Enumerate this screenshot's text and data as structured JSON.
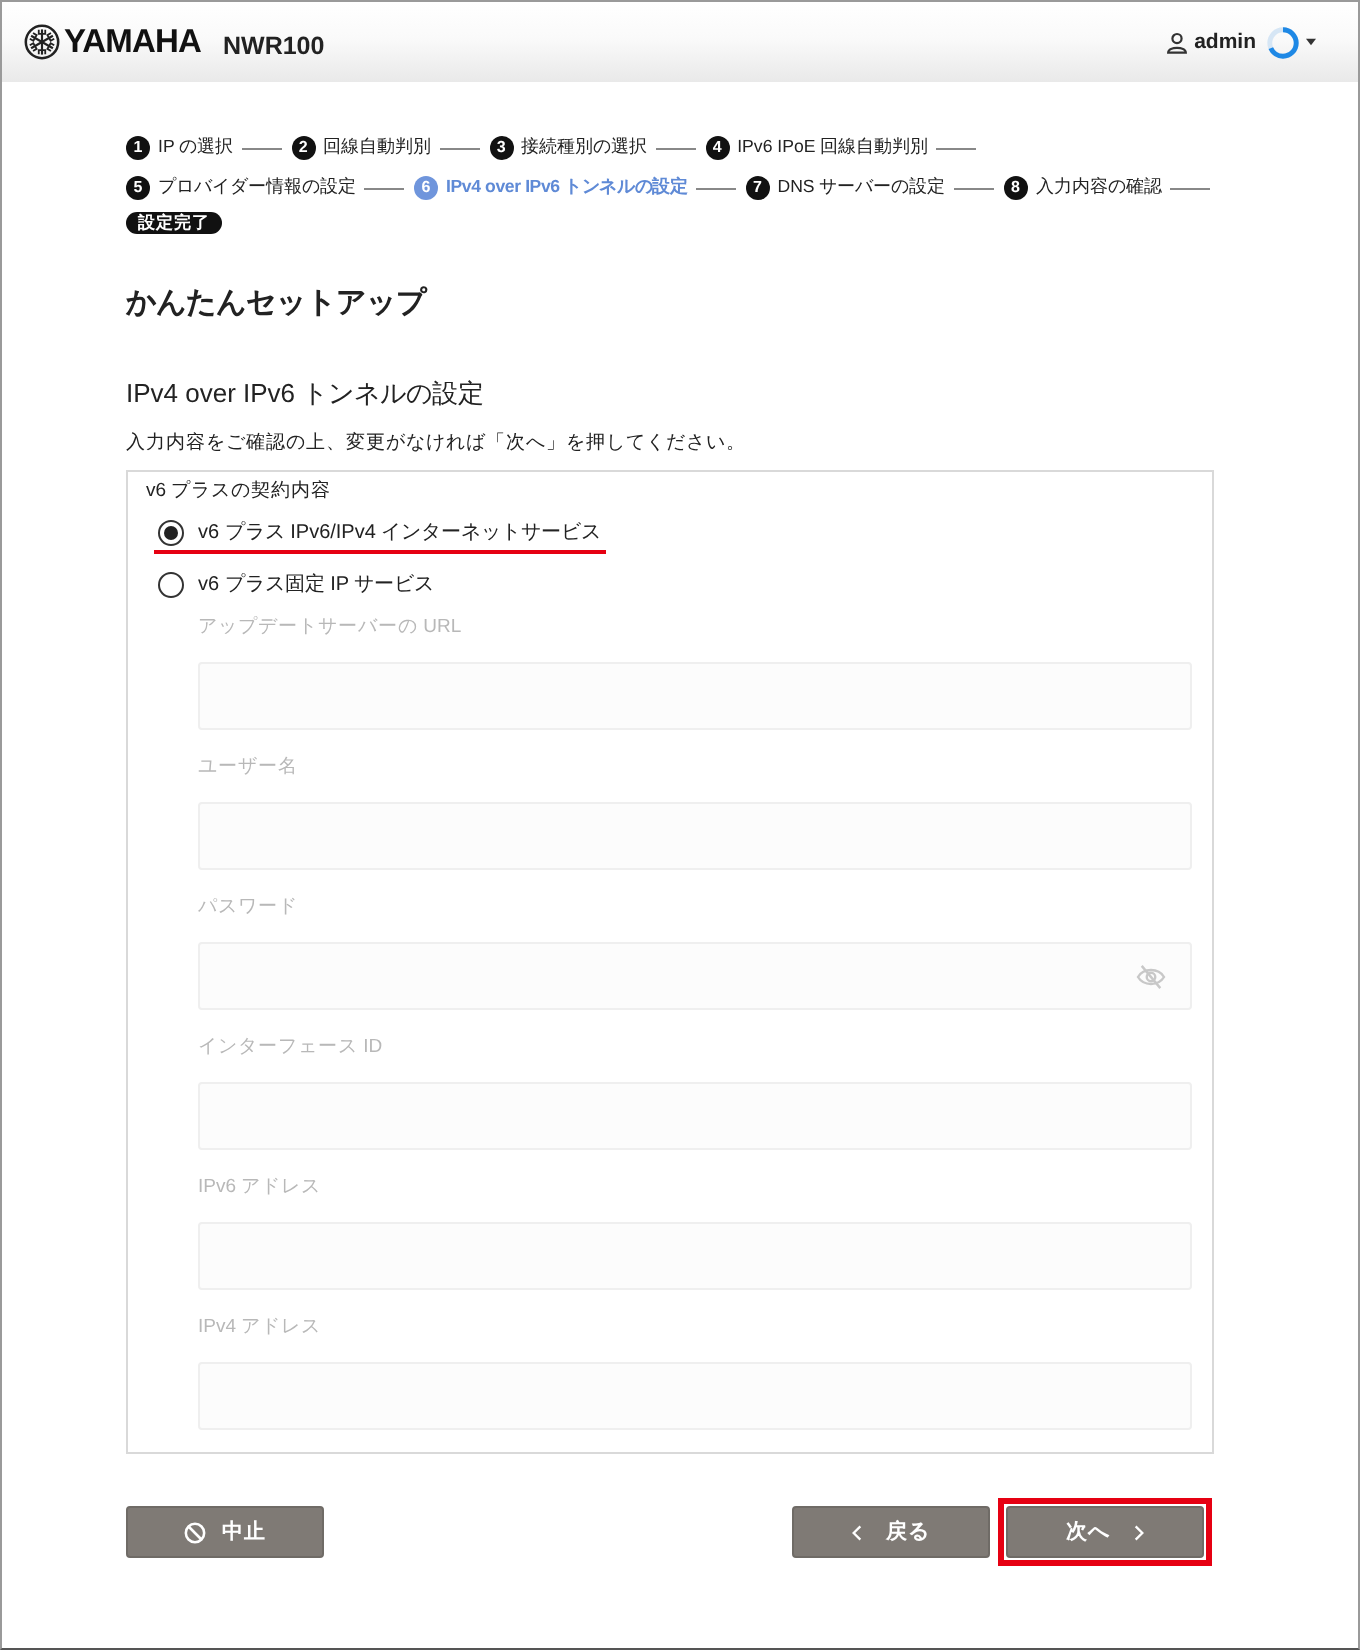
{
  "header": {
    "brand": "YAMAHA",
    "model": "NWR100",
    "user": "admin"
  },
  "steps": [
    {
      "number": "1",
      "label": "IP の選択",
      "selected": false
    },
    {
      "number": "2",
      "label": "回線自動判別",
      "selected": false
    },
    {
      "number": "3",
      "label": "接続種別の選択",
      "selected": false
    },
    {
      "number": "4",
      "label": "IPv6 IPoE 回線自動判別",
      "selected": false
    },
    {
      "number": "5",
      "label": "プロバイダー情報の設定",
      "selected": false
    },
    {
      "number": "6",
      "label": "IPv4 over IPv6 トンネルの設定",
      "selected": true
    },
    {
      "number": "7",
      "label": "DNS サーバーの設定",
      "selected": false
    },
    {
      "number": "8",
      "label": "入力内容の確認",
      "selected": false
    }
  ],
  "final_step": "設定完了",
  "page_title": "かんたんセットアップ",
  "section_title": "IPv4 over IPv6 トンネルの設定",
  "instruction": "入力内容をご確認の上、変更がなければ「次へ」を押してください。",
  "contract": {
    "label": "v6 プラスの契約内容",
    "options": [
      {
        "label": "v6 プラス IPv6/IPv4 インターネットサービス",
        "selected": true,
        "underlined": true
      },
      {
        "label": "v6 プラス固定 IP サービス",
        "selected": false,
        "underlined": false
      }
    ]
  },
  "fields": [
    {
      "label": "アップデートサーバーの URL",
      "kind": "text",
      "disabled": true
    },
    {
      "label": "ユーザー名",
      "kind": "text",
      "disabled": true
    },
    {
      "label": "パスワード",
      "kind": "password",
      "disabled": true
    },
    {
      "label": "インターフェース ID",
      "kind": "text",
      "disabled": true
    },
    {
      "label": "IPv6 アドレス",
      "kind": "text",
      "disabled": true
    },
    {
      "label": "IPv4 アドレス",
      "kind": "text",
      "disabled": true
    }
  ],
  "buttons": [
    {
      "label": "中止",
      "kind": "cancel",
      "highlighted": false
    },
    {
      "label": "戻る",
      "kind": "back",
      "highlighted": false
    },
    {
      "label": "次へ",
      "kind": "next",
      "highlighted": true
    }
  ]
}
